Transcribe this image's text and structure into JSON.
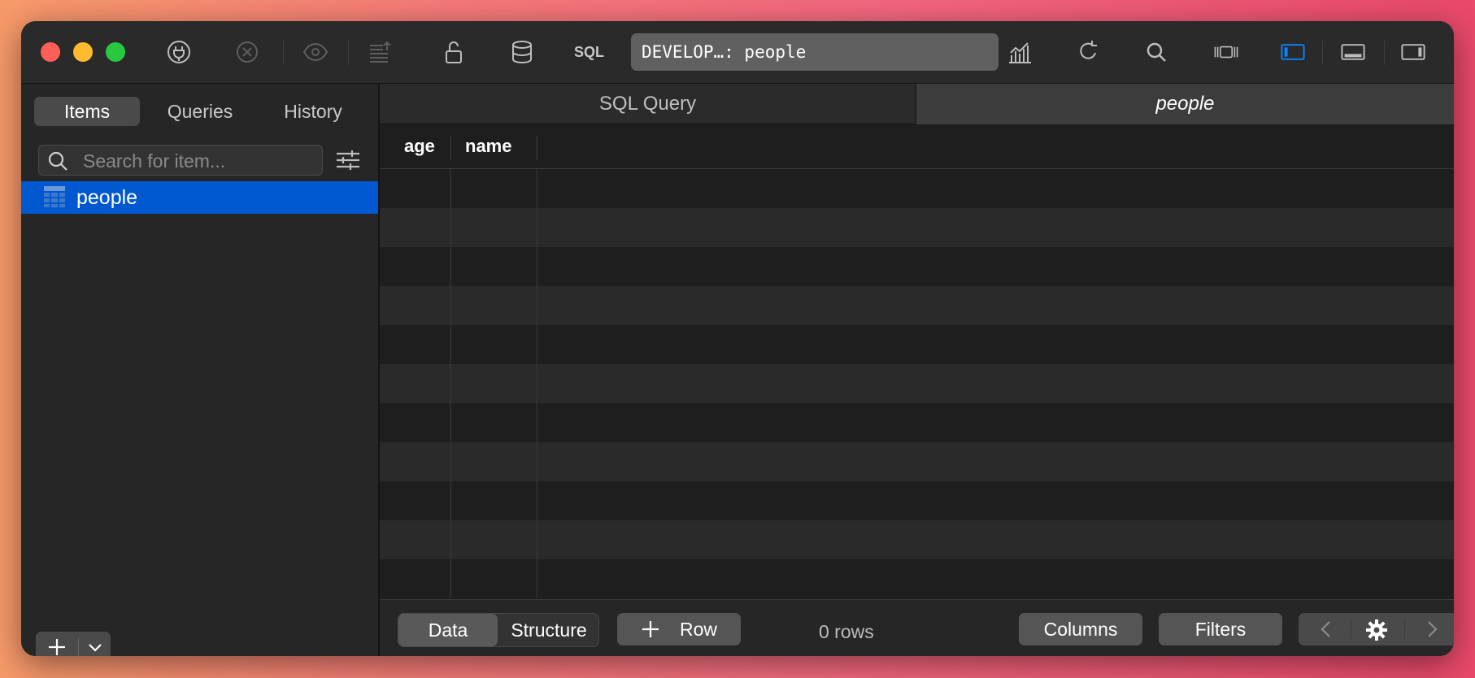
{
  "toolbar": {
    "sql_label": "SQL",
    "connection_title": "DEVELOP…: people",
    "accent": "#0a84ff"
  },
  "sidebar": {
    "tabs": [
      {
        "label": "Items",
        "active": true
      },
      {
        "label": "Queries",
        "active": false
      },
      {
        "label": "History",
        "active": false
      }
    ],
    "search_placeholder": "Search for item...",
    "items": [
      {
        "label": "people",
        "icon": "table-icon",
        "selected": true
      }
    ]
  },
  "main": {
    "tabs": [
      {
        "label": "SQL Query",
        "active": false
      },
      {
        "label": "people",
        "active": true
      }
    ],
    "columns": [
      "age",
      "name"
    ],
    "row_count_text": "0 rows"
  },
  "footer": {
    "data_label": "Data",
    "structure_label": "Structure",
    "add_row_label": "Row",
    "columns_label": "Columns",
    "filters_label": "Filters"
  },
  "colors": {
    "selection": "#0058d0",
    "close": "#fe5f57",
    "minimize": "#febc2e",
    "maximize": "#28c840"
  }
}
